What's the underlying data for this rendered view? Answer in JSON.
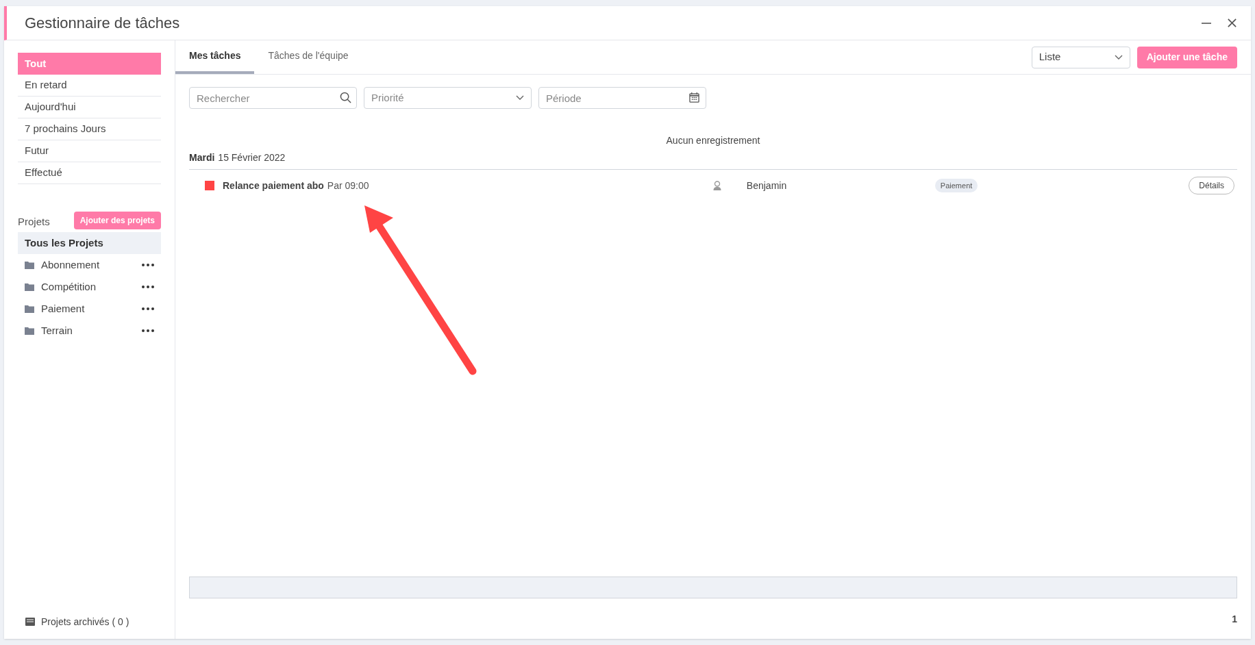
{
  "window": {
    "title": "Gestionnaire de tâches"
  },
  "sidebar": {
    "filters": [
      {
        "label": "Tout",
        "selected": true
      },
      {
        "label": "En retard",
        "selected": false
      },
      {
        "label": "Aujourd'hui",
        "selected": false
      },
      {
        "label": "7 prochains Jours",
        "selected": false
      },
      {
        "label": "Futur",
        "selected": false
      },
      {
        "label": "Effectué",
        "selected": false
      }
    ],
    "projects_label": "Projets",
    "add_projects_button": "Ajouter des projets",
    "all_projects": {
      "label": "Tous les Projets",
      "selected": true
    },
    "projects": [
      {
        "label": "Abonnement",
        "selected": false
      },
      {
        "label": "Compétition",
        "selected": false
      },
      {
        "label": "Paiement",
        "selected": false
      },
      {
        "label": "Terrain",
        "selected": false
      }
    ],
    "archived": "Projets archivés ( 0 )"
  },
  "tabs": [
    {
      "label": "Mes tâches",
      "selected": true
    },
    {
      "label": "Tâches de l'équipe",
      "selected": false
    }
  ],
  "view_select": {
    "value": "Liste"
  },
  "add_task_button": "Ajouter une tâche",
  "filters": {
    "search": {
      "placeholder": "Rechercher"
    },
    "priority": {
      "placeholder": "Priorité"
    },
    "period": {
      "placeholder": "Période"
    }
  },
  "empty_message": "Aucun enregistrement",
  "groups": [
    {
      "day": "Mardi",
      "date": "15 Février 2022",
      "tasks": [
        {
          "title": "Relance paiement abo",
          "due": "Par 09:00",
          "color": "#ff4444",
          "assignee": "Benjamin",
          "tag": "Paiement",
          "action": "Détails"
        }
      ]
    }
  ],
  "pagination": "1"
}
